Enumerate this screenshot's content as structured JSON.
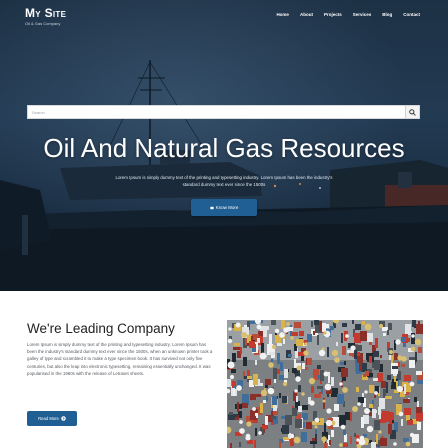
{
  "header": {
    "brand_name": "My Site",
    "brand_tagline": "Oil & Gas Company",
    "nav": [
      "Home",
      "About",
      "Projects",
      "Services",
      "Blog",
      "Contact"
    ]
  },
  "hero": {
    "search_placeholder": "Search",
    "title": "Oil And Natural Gas Resources",
    "subtitle": "Lorem Ipsum is simply dummy text of the printing and typesetting industry. Lorem Ipsum has been the industry's standard dummy text ever since the 1500s",
    "button_label": "Know More"
  },
  "about": {
    "title": "We're Leading Company",
    "text": "Lorem Ipsum is simply dummy text of the printing and typesetting industry. Lorem Ipsum has been the industry's standard dummy text ever since the 1500s, when an unknown printer took a galley of type and scrambled it to make a type specimen book. It has survived not only five centuries, but also the leap into electronic typesetting, remaining essentially unchanged. It was popularised in the 1960s with the release of Letraset sheets.",
    "button_label": "Read More"
  },
  "colors": {
    "accent": "#1f5f94",
    "hero_overlay": "#1d3145",
    "text_dark": "#222222"
  },
  "icons": {
    "search": "search-icon",
    "hero_button": "arrow-icon",
    "read_button": "arrow-right-icon"
  }
}
